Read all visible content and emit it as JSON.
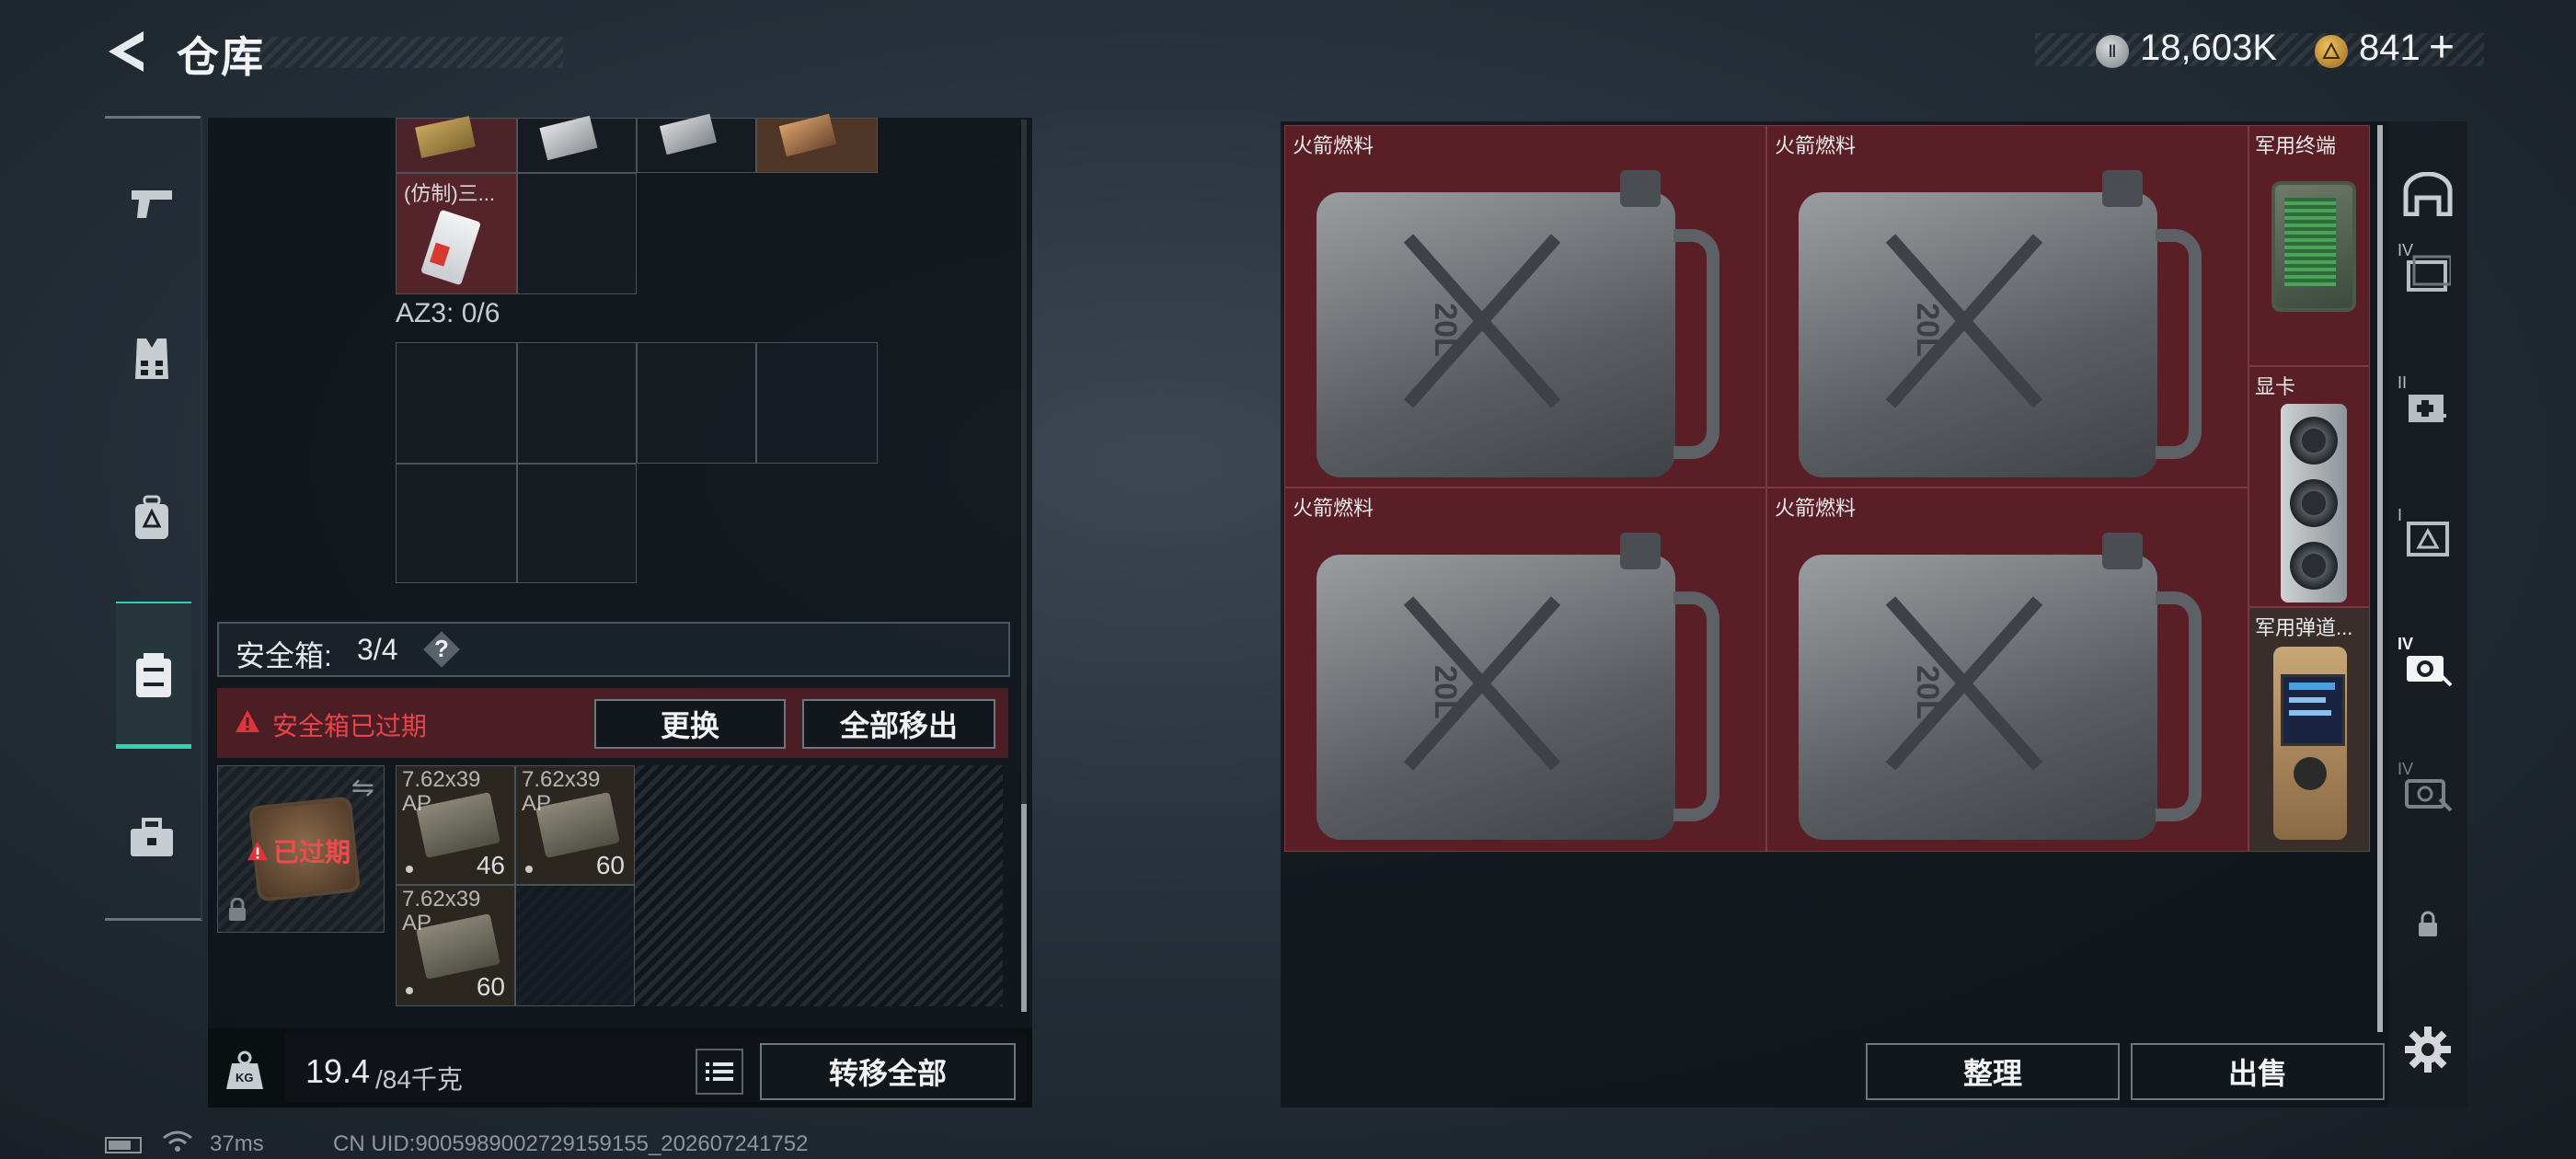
{
  "header": {
    "title": "仓库",
    "currency_1": "18,603K",
    "currency_2": "841",
    "plus": "+"
  },
  "sidebar_tabs": [
    "pistol-icon",
    "armor-vest-icon",
    "backpack-icon",
    "safe-box-icon",
    "toolbox-icon"
  ],
  "left_panel": {
    "top_item_label": "(仿制)三...",
    "az3_label": "AZ3: 0/6",
    "safe_box_label": "安全箱:",
    "safe_box_count": "3/4",
    "help_glyph": "?",
    "expired_warning": "安全箱已过期",
    "replace_button": "更换",
    "remove_all_button": "全部移出",
    "expired_badge": "已过期",
    "ammo": [
      {
        "name": "7.62x39 AP",
        "count": "46"
      },
      {
        "name": "7.62x39 AP",
        "count": "60"
      },
      {
        "name": "7.62x39 AP",
        "count": "60"
      }
    ],
    "weight_value": "19.4",
    "weight_max": "/84千克",
    "kg_icon_text": "KG",
    "transfer_all_button": "转移全部"
  },
  "stash": {
    "items": [
      {
        "name": "火箭燃料",
        "can_text": "20L"
      },
      {
        "name": "火箭燃料",
        "can_text": "20L"
      },
      {
        "name": "火箭燃料",
        "can_text": "20L"
      },
      {
        "name": "火箭燃料",
        "can_text": "20L"
      }
    ],
    "small_items": [
      "军用终端",
      "显卡",
      "军用弹道..."
    ],
    "organize_button": "整理",
    "sell_button": "出售"
  },
  "right_tabs": [
    "safehouse-icon",
    "IV",
    "II",
    "I",
    "IV",
    "IV"
  ],
  "status_bar": {
    "ping": "37ms",
    "uid": "CN UID:9005989002729159155_202607241752"
  },
  "colors": {
    "item_red_bg": "#5a1f26",
    "warning_red": "#e0343a",
    "accent_teal": "#2fd0b3"
  }
}
